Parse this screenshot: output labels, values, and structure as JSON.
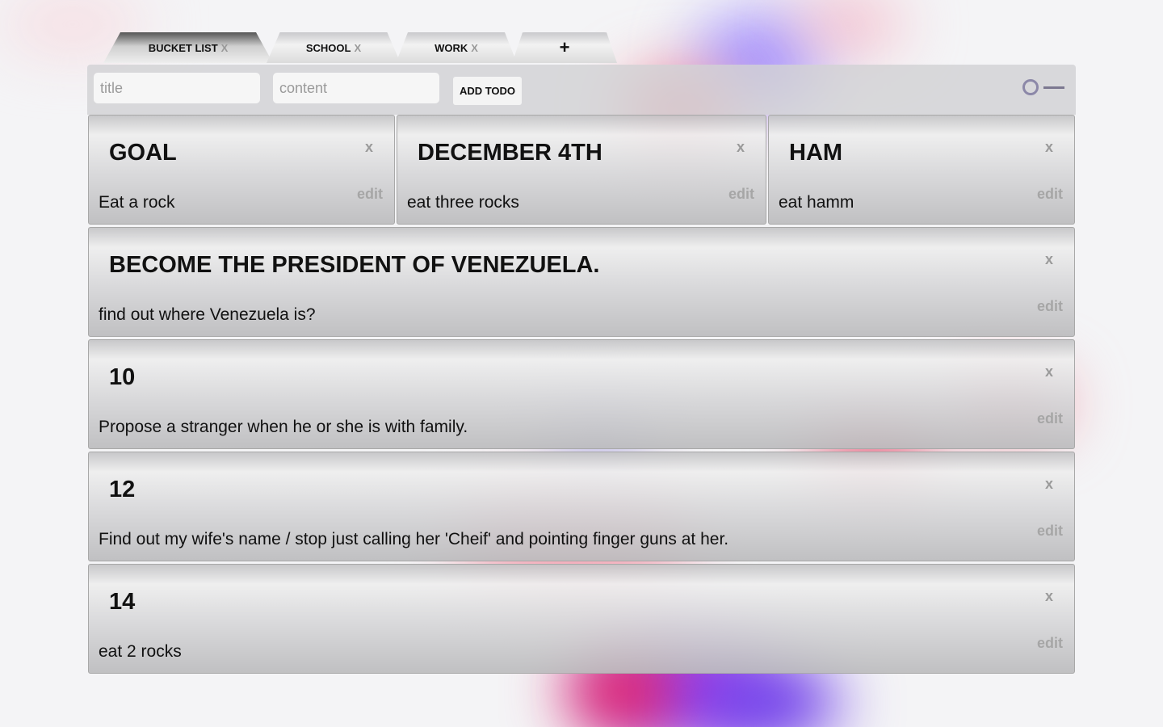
{
  "tabs": [
    {
      "label": "BUCKET LIST",
      "close": "X"
    },
    {
      "label": "SCHOOL",
      "close": "X"
    },
    {
      "label": "WORK",
      "close": "X"
    }
  ],
  "add_tab_label": "+",
  "form": {
    "title_placeholder": "title",
    "content_placeholder": "content",
    "add_button": "ADD TODO"
  },
  "todos": [
    {
      "title": "GOAL",
      "content": "Eat a rock",
      "delete": "x",
      "edit": "edit"
    },
    {
      "title": "DECEMBER 4TH",
      "content": "eat three rocks",
      "delete": "x",
      "edit": "edit"
    },
    {
      "title": "HAM",
      "content": "eat hamm",
      "delete": "x",
      "edit": "edit"
    },
    {
      "title": "BECOME THE PRESIDENT OF VENEZUELA.",
      "content": "find out where Venezuela is?",
      "delete": "x",
      "edit": "edit"
    },
    {
      "title": "10",
      "content": "Propose a stranger when he or she is with family.",
      "delete": "x",
      "edit": "edit"
    },
    {
      "title": "12",
      "content": "Find out my wife's name / stop just calling her 'Cheif' and pointing finger guns at her.",
      "delete": "x",
      "edit": "edit"
    },
    {
      "title": "14",
      "content": "eat 2 rocks",
      "delete": "x",
      "edit": "edit"
    }
  ]
}
